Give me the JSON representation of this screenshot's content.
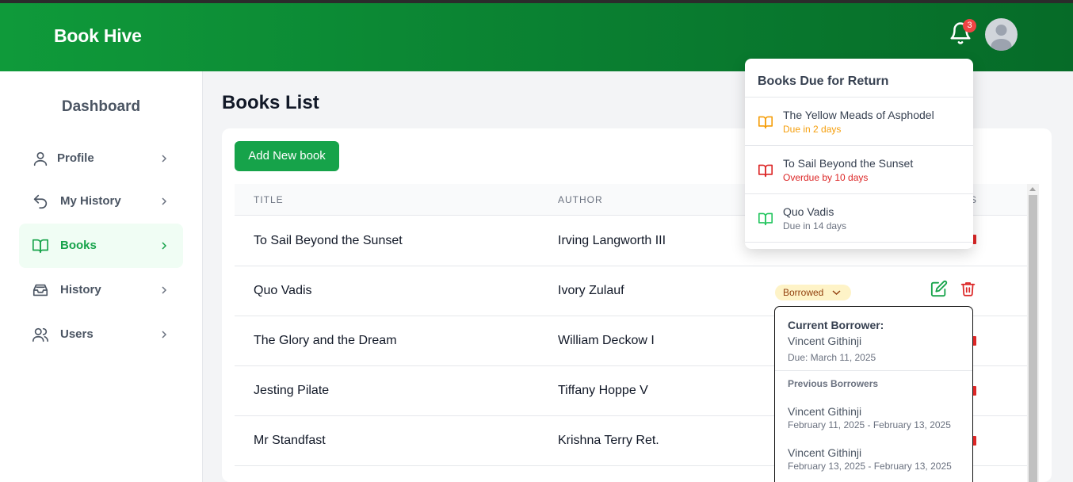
{
  "header": {
    "brand": "Book Hive",
    "notification_count": "3"
  },
  "sidebar": {
    "title": "Dashboard",
    "items": [
      {
        "label": "Profile",
        "icon": "user-icon"
      },
      {
        "label": "My History",
        "icon": "undo-arrow-icon"
      },
      {
        "label": "Books",
        "icon": "open-book-icon",
        "active": true
      },
      {
        "label": "History",
        "icon": "inbox-icon"
      },
      {
        "label": "Users",
        "icon": "users-icon"
      }
    ]
  },
  "main": {
    "title": "Books List",
    "add_button": "Add New book",
    "columns": [
      "TITLE",
      "AUTHOR",
      "S"
    ],
    "rows": [
      {
        "title": "To Sail Beyond the Sunset",
        "author": "Irving Langworth III"
      },
      {
        "title": "Quo Vadis",
        "author": "Ivory Zulauf",
        "status": "Borrowed"
      },
      {
        "title": "The Glory and the Dream",
        "author": "William Deckow I"
      },
      {
        "title": "Jesting Pilate",
        "author": "Tiffany Hoppe V"
      },
      {
        "title": "Mr Standfast",
        "author": "Krishna Terry Ret."
      }
    ]
  },
  "due_panel": {
    "title": "Books Due for Return",
    "items": [
      {
        "title": "The Yellow Meads of Asphodel",
        "sub": "Due in 2 days",
        "color": "#f59e0b"
      },
      {
        "title": "To Sail Beyond the Sunset",
        "sub": "Overdue by 10 days",
        "color": "#dc2626"
      },
      {
        "title": "Quo Vadis",
        "sub": "Due in 14 days",
        "color": "#22c55e"
      }
    ]
  },
  "borrow_panel": {
    "current_heading": "Current Borrower:",
    "current_name": "Vincent Githinji",
    "current_due": "Due: March 11, 2025",
    "previous_heading": "Previous Borrowers",
    "previous": [
      {
        "name": "Vincent Githinji",
        "dates": "February 11, 2025 - February 13, 2025"
      },
      {
        "name": "Vincent Githinji",
        "dates": "February 13, 2025 - February 13, 2025"
      }
    ]
  },
  "colors": {
    "brand_green": "#16a34a",
    "danger": "#dc2626",
    "warning": "#f59e0b"
  }
}
